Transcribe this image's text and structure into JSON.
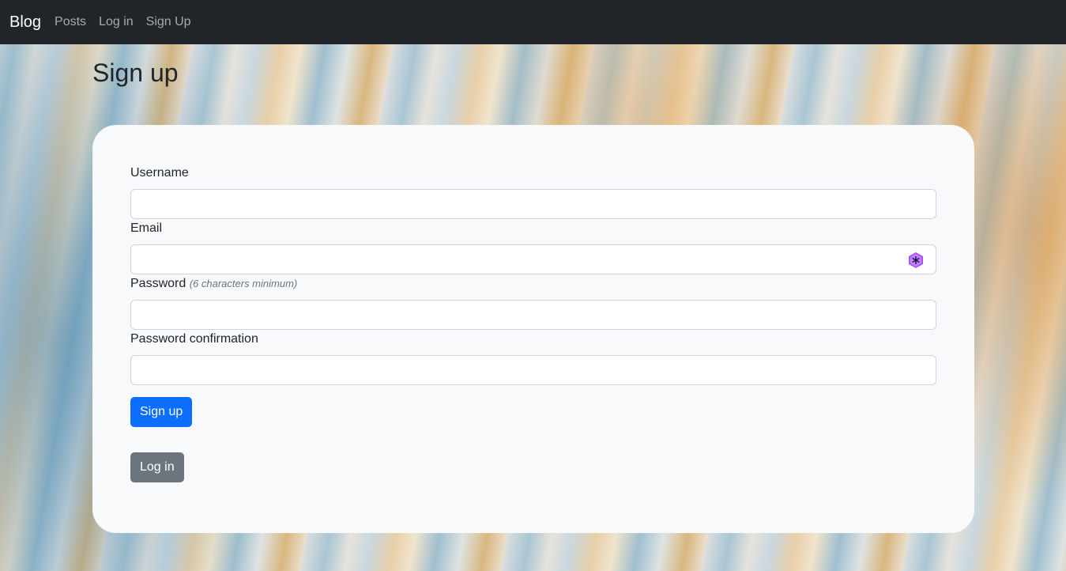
{
  "nav": {
    "brand": "Blog",
    "links": [
      "Posts",
      "Log in",
      "Sign Up"
    ]
  },
  "page": {
    "title": "Sign up"
  },
  "form": {
    "username_label": "Username",
    "email_label": "Email",
    "password_label": "Password",
    "password_hint": "(6 characters minimum)",
    "password_confirmation_label": "Password confirmation",
    "username_value": "",
    "email_value": "",
    "password_value": "",
    "password_confirmation_value": "",
    "submit_label": "Sign up",
    "login_label": "Log in"
  },
  "colors": {
    "navbar": "#212529",
    "primary": "#0d6efd",
    "secondary": "#6c757d",
    "card": "#f8f9fa",
    "extension_icon": "#a855f7"
  },
  "icons": {
    "email_field_extension": "password-manager-icon"
  }
}
